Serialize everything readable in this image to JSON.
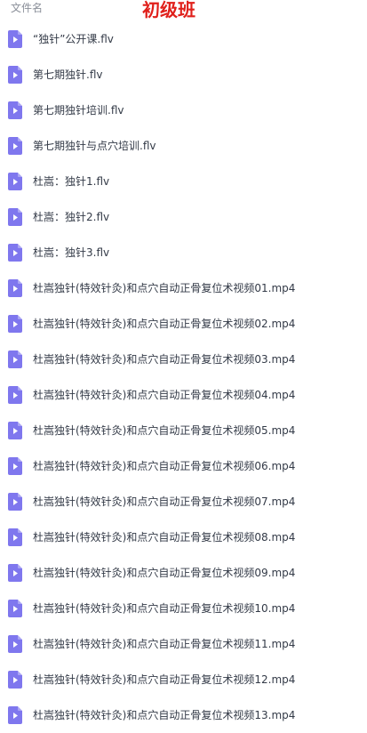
{
  "header": {
    "column_label": "文件名",
    "overlay_title": "初级班"
  },
  "colors": {
    "icon": "#7f77ee",
    "overlay_title": "#e0201b"
  },
  "files": [
    {
      "name": "“独针”公开课.flv",
      "icon": "video-file-icon"
    },
    {
      "name": "第七期独针.flv",
      "icon": "video-file-icon"
    },
    {
      "name": "第七期独针培训.flv",
      "icon": "video-file-icon"
    },
    {
      "name": "第七期独针与点穴培训.flv",
      "icon": "video-file-icon"
    },
    {
      "name": "杜嵩：独针1.flv",
      "icon": "video-file-icon"
    },
    {
      "name": "杜嵩：独针2.flv",
      "icon": "video-file-icon"
    },
    {
      "name": "杜嵩：独针3.flv",
      "icon": "video-file-icon"
    },
    {
      "name": "杜嵩独针(特效针灸)和点穴自动正骨复位术视频01.mp4",
      "icon": "video-file-icon"
    },
    {
      "name": "杜嵩独针(特效针灸)和点穴自动正骨复位术视频02.mp4",
      "icon": "video-file-icon"
    },
    {
      "name": "杜嵩独针(特效针灸)和点穴自动正骨复位术视频03.mp4",
      "icon": "video-file-icon"
    },
    {
      "name": "杜嵩独针(特效针灸)和点穴自动正骨复位术视频04.mp4",
      "icon": "video-file-icon"
    },
    {
      "name": "杜嵩独针(特效针灸)和点穴自动正骨复位术视频05.mp4",
      "icon": "video-file-icon"
    },
    {
      "name": "杜嵩独针(特效针灸)和点穴自动正骨复位术视频06.mp4",
      "icon": "video-file-icon"
    },
    {
      "name": "杜嵩独针(特效针灸)和点穴自动正骨复位术视频07.mp4",
      "icon": "video-file-icon"
    },
    {
      "name": "杜嵩独针(特效针灸)和点穴自动正骨复位术视频08.mp4",
      "icon": "video-file-icon"
    },
    {
      "name": "杜嵩独针(特效针灸)和点穴自动正骨复位术视频09.mp4",
      "icon": "video-file-icon"
    },
    {
      "name": "杜嵩独针(特效针灸)和点穴自动正骨复位术视频10.mp4",
      "icon": "video-file-icon"
    },
    {
      "name": "杜嵩独针(特效针灸)和点穴自动正骨复位术视频11.mp4",
      "icon": "video-file-icon"
    },
    {
      "name": "杜嵩独针(特效针灸)和点穴自动正骨复位术视频12.mp4",
      "icon": "video-file-icon"
    },
    {
      "name": "杜嵩独针(特效针灸)和点穴自动正骨复位术视频13.mp4",
      "icon": "video-file-icon"
    }
  ]
}
